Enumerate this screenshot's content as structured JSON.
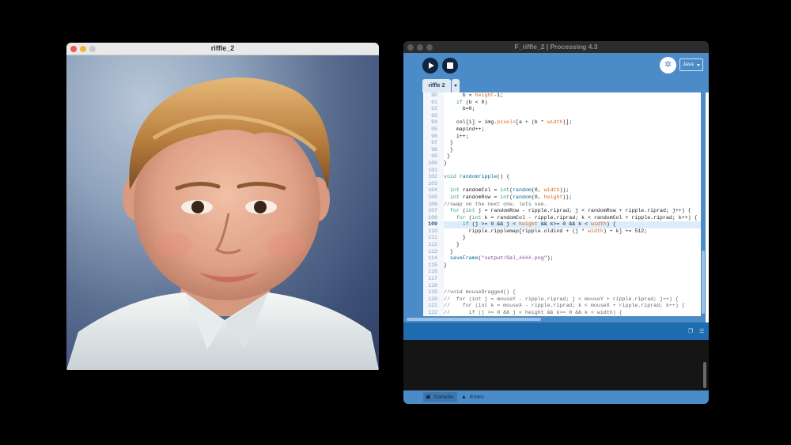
{
  "sketch": {
    "title": "riffle_2"
  },
  "ide": {
    "title": "F_riffle_2 | Processing 4.3",
    "mode": "Java",
    "tab": "riffle 2",
    "bottom_tabs": [
      "Console",
      "Errors"
    ]
  },
  "colors": {
    "accent": "#4b8bc8",
    "status_bar": "#1f6cb0",
    "highlight": "#dcecfb"
  },
  "code": [
    {
      "n": "90",
      "t": "      b = height-1;"
    },
    {
      "n": "91",
      "t": "    if (b < 0)"
    },
    {
      "n": "92",
      "t": "      b=0;"
    },
    {
      "n": "93",
      "t": ""
    },
    {
      "n": "94",
      "t": "    col[i] = img.pixels[a + (b * width)];"
    },
    {
      "n": "95",
      "t": "    mapind++;"
    },
    {
      "n": "96",
      "t": "    i++;"
    },
    {
      "n": "97",
      "t": "  }"
    },
    {
      "n": "98",
      "t": "  }"
    },
    {
      "n": "99",
      "t": " }"
    },
    {
      "n": "100",
      "t": "}"
    },
    {
      "n": "101",
      "t": ""
    },
    {
      "n": "102",
      "t": "void randomripple() {"
    },
    {
      "n": "103",
      "t": ""
    },
    {
      "n": "104",
      "t": "  int randomCol = int(random(0, width));"
    },
    {
      "n": "105",
      "t": "  int randomRow = int(random(0, height));"
    },
    {
      "n": "106",
      "t": "//swap on the next one. lets see."
    },
    {
      "n": "107",
      "t": "  for (int j = randomRow - ripple.riprad; j < randomRow + ripple.riprad; j++) {"
    },
    {
      "n": "108",
      "t": "    for (int k = randomCol - ripple.riprad; k < randomCol + ripple.riprad; k++) {"
    },
    {
      "n": "109",
      "t": "      if (j >= 0 && j < height && k>= 0 && k < width) {"
    },
    {
      "n": "110",
      "t": "        ripple.ripplemap[ripple.oldind + (j * width) + k] += 512;"
    },
    {
      "n": "111",
      "t": "      }"
    },
    {
      "n": "112",
      "t": "    }"
    },
    {
      "n": "113",
      "t": "  }"
    },
    {
      "n": "114",
      "t": "  saveFrame(\"output/Gal_####.png\");"
    },
    {
      "n": "115",
      "t": "}"
    },
    {
      "n": "116",
      "t": ""
    },
    {
      "n": "117",
      "t": ""
    },
    {
      "n": "118",
      "t": ""
    },
    {
      "n": "119",
      "t": "//void mouseDragged() {"
    },
    {
      "n": "120",
      "t": "//  for (int j = mouseY - ripple.riprad; j < mouseY + ripple.riprad; j++) {"
    },
    {
      "n": "121",
      "t": "//    for (int k = mouseX - ripple.riprad; k < mouseX + ripple.riprad; k++) {"
    },
    {
      "n": "122",
      "t": "//      if (j >= 0 && j < height && k>= 0 && k < width) {"
    }
  ],
  "highlight_line": "109"
}
